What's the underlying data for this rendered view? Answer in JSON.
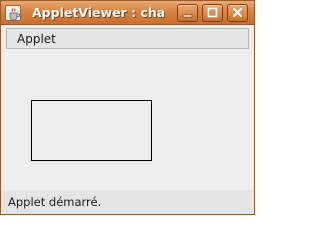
{
  "window": {
    "title": "AppletViewer : cha",
    "icon": "java-coffee-cup-icon",
    "controls": {
      "minimize_icon": "minimize-icon",
      "maximize_icon": "maximize-icon",
      "close_icon": "close-icon"
    },
    "title_bar_color": "#d98442"
  },
  "menubar": {
    "items": [
      {
        "label": "Applet"
      }
    ]
  },
  "applet_canvas": {
    "shapes": [
      {
        "type": "rectangle",
        "stroke": "#000000",
        "fill": "none"
      }
    ]
  },
  "statusbar": {
    "text": "Applet démarré."
  }
}
